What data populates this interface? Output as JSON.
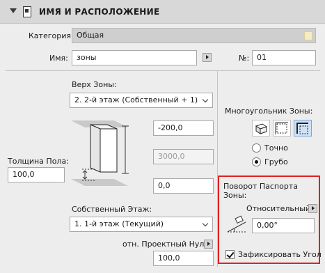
{
  "header": {
    "title": "ИМЯ И РАСПОЛОЖЕНИЕ"
  },
  "category": {
    "label": "Категория:",
    "value": "Общая"
  },
  "name": {
    "label": "Имя:",
    "value": "зоны"
  },
  "number": {
    "label": "№:",
    "value": "01"
  },
  "top_zone": {
    "label": "Верх Зоны:",
    "value": "2. 2-й этаж (Собственный + 1)"
  },
  "height_fields": {
    "top_offset": "-200,0",
    "height": "3000,0",
    "bottom_offset": "0,0"
  },
  "floor_thickness": {
    "label": "Толщина Пола:",
    "value": "100,0"
  },
  "home_story": {
    "label": "Собственный Этаж:",
    "value": "1. 1-й этаж (Текущий)"
  },
  "reference": {
    "label": "отн. Проектный Нуль",
    "value": "100,0"
  },
  "polygon": {
    "label": "Многоугольник Зоны:",
    "options": [
      "Точно",
      "Грубо"
    ],
    "selected": "Грубо",
    "selected_tool": "inner-edge"
  },
  "stamp_rotation": {
    "title": "Поворот Паспорта Зоны:",
    "mode": "Относительный",
    "angle": "0,00°",
    "fix_angle_label": "Зафиксировать Угол",
    "fix_angle_checked": true
  },
  "colors": {
    "highlight": "#e02020",
    "swatch": "#f6ebc2",
    "selected_tool": "#cfe2f5"
  }
}
